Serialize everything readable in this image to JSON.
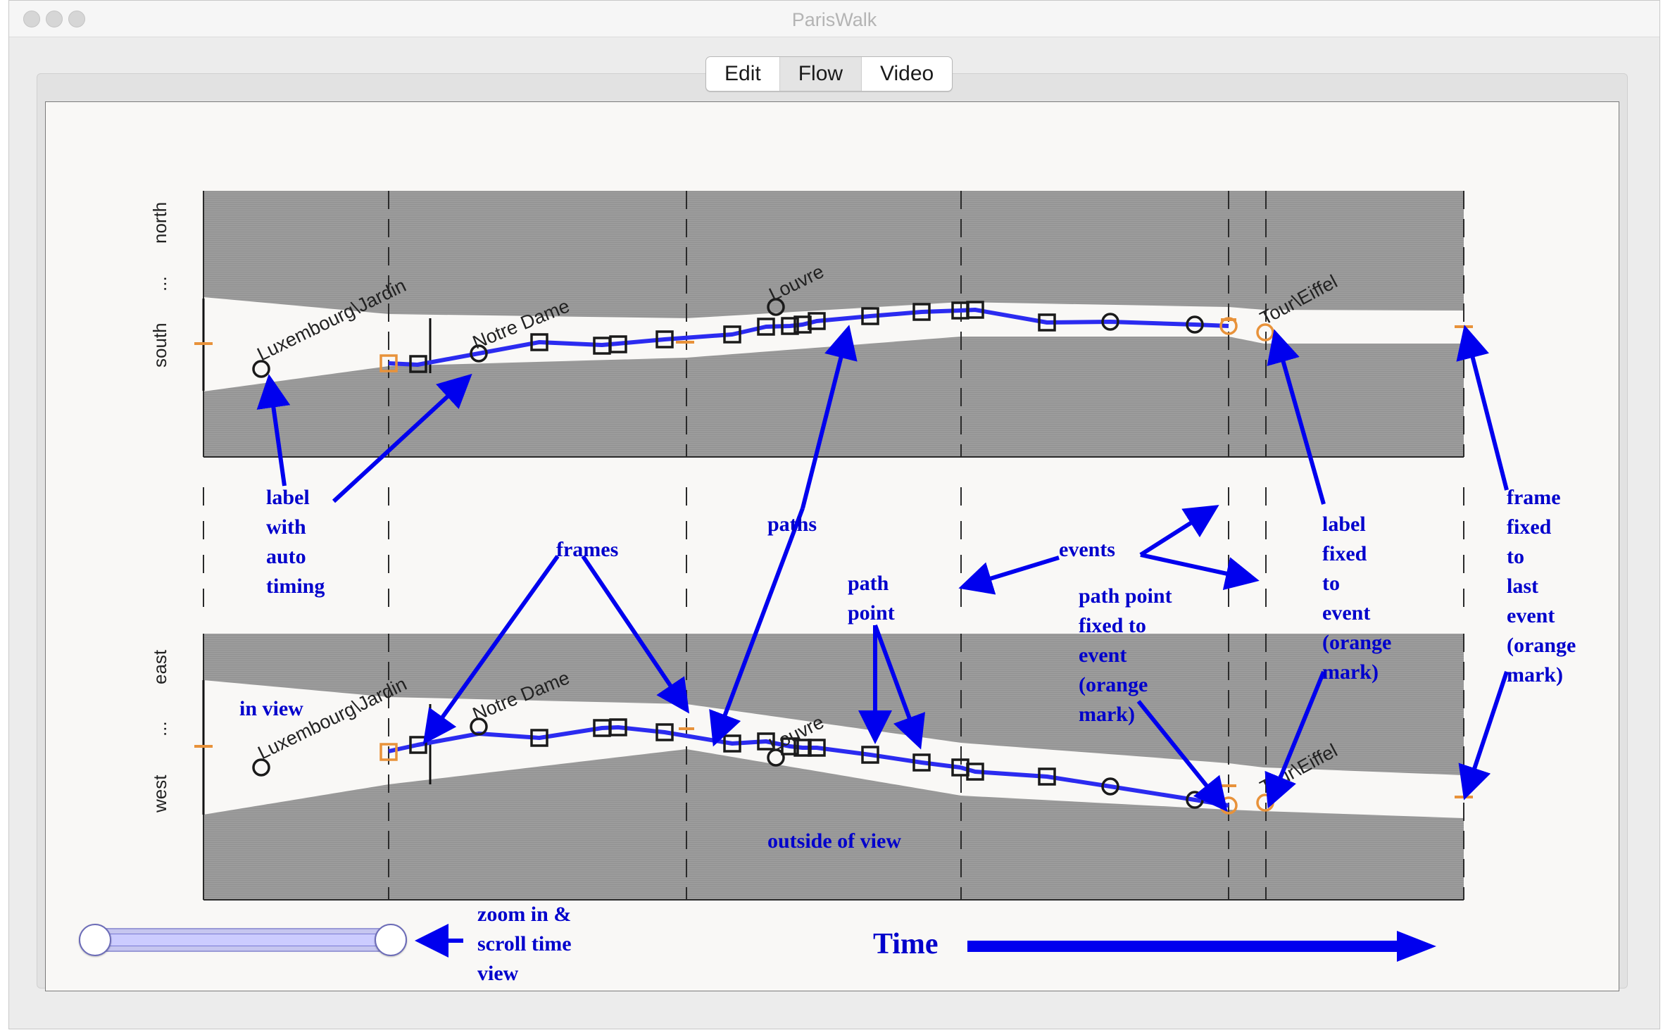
{
  "window": {
    "title": "ParisWalk"
  },
  "tabs": [
    {
      "label": "Edit"
    },
    {
      "label": "Flow"
    },
    {
      "label": "Video"
    }
  ],
  "selected_tab": "Flow",
  "colors": {
    "path": "#2b2bf0",
    "annotation": "#0000cc",
    "event_mark": "#e8923a",
    "out_of_view": "#9a9a9a",
    "in_view": "#f9f8f6"
  },
  "top_plot": {
    "axis_labels": [
      "north",
      "...",
      "south"
    ],
    "places": [
      "Luxembourg\\Jardin",
      "Notre Dame",
      "Louvre",
      "Tour\\Eiffel"
    ]
  },
  "bottom_plot": {
    "axis_labels": [
      "east",
      "...",
      "west"
    ],
    "places": [
      "Luxembourg\\Jardin",
      "Notre Dame",
      "Louvre",
      "Tour\\Eiffel"
    ]
  },
  "annotations": {
    "label_auto": [
      "label",
      "with",
      "auto",
      "timing"
    ],
    "frames": "frames",
    "paths": "paths",
    "path_point": [
      "path",
      "point"
    ],
    "events": "events",
    "path_point_fixed": [
      "path point",
      "fixed to",
      "event",
      "(orange",
      "mark)"
    ],
    "label_fixed": [
      "label",
      "fixed",
      "to",
      "event",
      "(orange",
      "mark)"
    ],
    "frame_fixed": [
      "frame",
      "fixed",
      "to",
      "last",
      "event",
      "(orange",
      "mark)"
    ],
    "in_view": "in view",
    "outside_view": "outside of view",
    "zoom": [
      "zoom in &",
      "scroll time",
      "view"
    ],
    "time": "Time"
  }
}
